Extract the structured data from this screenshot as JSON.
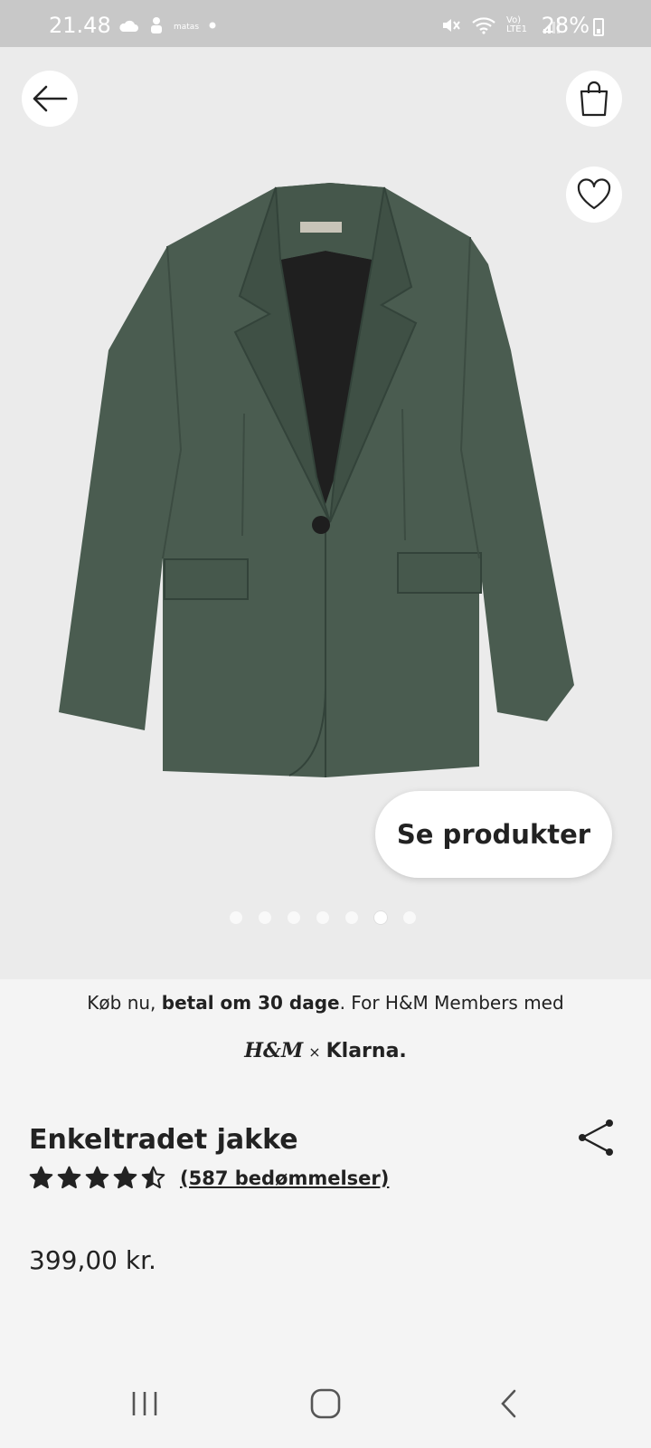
{
  "status_bar": {
    "time": "21.48",
    "battery": "28%",
    "network_label": "Vo) LTE1"
  },
  "hero": {
    "cta_label": "Se produkter",
    "carousel": {
      "count": 7,
      "active_index": 5
    },
    "jacket_color": "#4a5c50"
  },
  "promo": {
    "text_before": "Køb nu, ",
    "text_bold": "betal om 30 dage",
    "text_after": ". For H&M Members med",
    "brand_hm": "H&M",
    "brand_sep": "×",
    "brand_klarna": "Klarna."
  },
  "product": {
    "title": "Enkeltradet jakke",
    "rating_value": 4.5,
    "reviews_label": "(587 bedømmelser)",
    "price": "399,00 kr."
  },
  "icons": {
    "back": "arrow-left-icon",
    "bag": "shopping-bag-icon",
    "heart": "heart-icon",
    "share": "share-icon",
    "star": "star-icon"
  }
}
